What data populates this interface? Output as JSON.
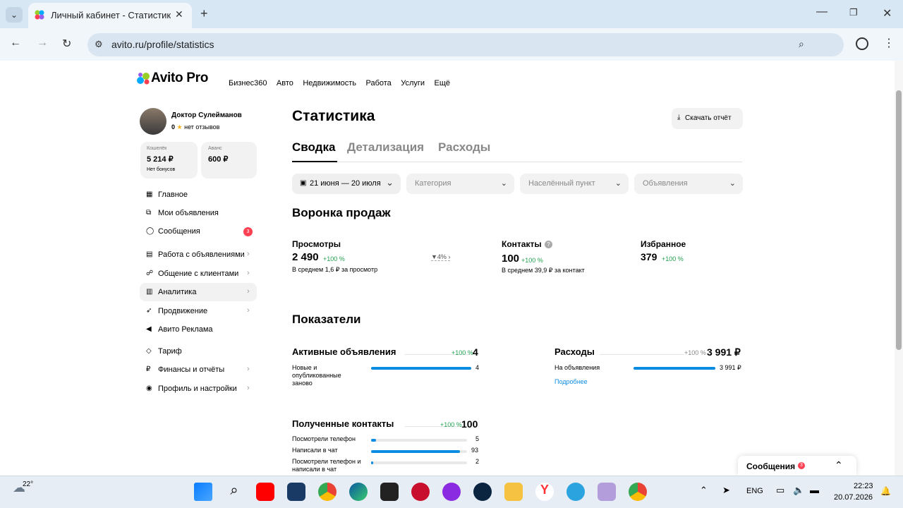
{
  "browser": {
    "tab_title": "Личный кабинет - Статистика",
    "url": "avito.ru/profile/statistics"
  },
  "header": {
    "logo": "Avito Pro",
    "nav": [
      "Бизнес360",
      "Авто",
      "Недвижимость",
      "Работа",
      "Услуги",
      "Ещё"
    ]
  },
  "profile": {
    "name": "Доктор Сулейманов",
    "rating": "0",
    "reviews": "нет отзывов",
    "wallet_label": "Кошелёк",
    "wallet_value": "5 214 ₽",
    "wallet_note": "Нет бонусов",
    "advance_label": "Аванс",
    "advance_value": "600 ₽"
  },
  "sidebar": {
    "items": [
      {
        "label": "Главное",
        "icon": "grid-icon"
      },
      {
        "label": "Мои объявления",
        "icon": "copy-icon"
      },
      {
        "label": "Сообщения",
        "icon": "chat-icon",
        "badge": "3"
      },
      {
        "label": "Работа с объявлениями",
        "icon": "document-icon"
      },
      {
        "label": "Общение с клиентами",
        "icon": "people-icon"
      },
      {
        "label": "Аналитика",
        "icon": "chart-icon"
      },
      {
        "label": "Продвижение",
        "icon": "rocket-icon"
      },
      {
        "label": "Авито Реклама",
        "icon": "megaphone-icon"
      },
      {
        "label": "Тариф",
        "icon": "diamond-icon"
      },
      {
        "label": "Финансы и отчёты",
        "icon": "ruble-icon"
      },
      {
        "label": "Профиль и настройки",
        "icon": "user-circle-icon"
      }
    ]
  },
  "main": {
    "title": "Статистика",
    "download_label": "Скачать отчёт",
    "tabs": [
      "Сводка",
      "Детализация",
      "Расходы"
    ],
    "filters": {
      "date": "21 июня — 20 июля",
      "category": "Категория",
      "city": "Населённый пункт",
      "ads": "Объявления"
    },
    "funnel": {
      "title": "Воронка продаж",
      "views_label": "Просмотры",
      "views_value": "2 490",
      "views_delta": "+100 %",
      "views_note": "В среднем 1,6 ₽ за просмотр",
      "conversion": "4%",
      "contacts_label": "Контакты",
      "contacts_value": "100",
      "contacts_delta": "+100 %",
      "contacts_note": "В среднем 39,9 ₽ за контакт",
      "fav_label": "Избранное",
      "fav_value": "379",
      "fav_delta": "+100 %"
    },
    "metrics": {
      "title": "Показатели",
      "active_label": "Активные объявления",
      "active_delta": "+100 %",
      "active_value": "4",
      "active_rows": [
        {
          "label": "Новые и опубликованные заново",
          "value": "4",
          "fill": 1.0
        }
      ],
      "expenses_label": "Расходы",
      "expenses_delta": "+100 %",
      "expenses_value": "3 991 ₽",
      "expenses_rows": [
        {
          "label": "На объявления",
          "value": "3 991 ₽",
          "fill": 1.0
        }
      ],
      "expenses_link": "Подробнее",
      "contacts_label": "Полученные контакты",
      "contacts_delta": "+100 %",
      "contacts_value": "100",
      "contacts_rows": [
        {
          "label": "Посмотрели телефон",
          "value": "5",
          "fill": 0.05
        },
        {
          "label": "Написали в чат",
          "value": "93",
          "fill": 0.93
        },
        {
          "label": "Посмотрели телефон и написали в чат",
          "value": "2",
          "fill": 0.02
        }
      ]
    }
  },
  "messages_popup": {
    "label": "Сообщения",
    "badge": "3"
  },
  "taskbar": {
    "weather": "22°",
    "lang": "ENG",
    "time": "22:23",
    "date": "20.07.2026"
  },
  "colors": {
    "accent": "#0a8ce0",
    "green": "#22a24f",
    "badge": "#ff4053"
  }
}
